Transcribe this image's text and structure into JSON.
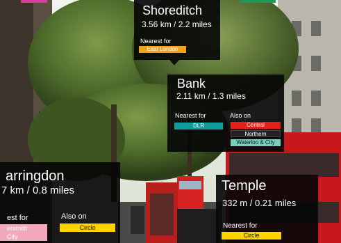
{
  "scene": {
    "description_icon": "street-camera-view"
  },
  "stations": {
    "shoreditch": {
      "name": "Shoreditch",
      "distance": "3.56 km / 2.2 miles",
      "nearest_label": "Nearest for",
      "nearest_lines": [
        {
          "name": "East London",
          "bg": "#f0a21e",
          "fg": "#ffffff"
        }
      ]
    },
    "bank": {
      "name": "Bank",
      "distance": "2.11 km / 1.3 miles",
      "nearest_label": "Nearest for",
      "also_label": "Also on",
      "nearest_lines": [
        {
          "name": "DLR",
          "bg": "#0f9c9b",
          "fg": "#ffffff"
        }
      ],
      "also_lines": [
        {
          "name": "Central",
          "bg": "#e32017",
          "fg": "#ffffff"
        },
        {
          "name": "Northern",
          "bg": "#222222",
          "fg": "#ffffff"
        },
        {
          "name": "Waterloo & City",
          "bg": "#76d0bd",
          "fg": "#111111"
        }
      ]
    },
    "farringdon": {
      "name": "arringdon",
      "distance": "7 km / 0.8 miles",
      "nearest_label": "est for",
      "also_label": "Also on",
      "nearest_lines": [
        {
          "name": "ersmith",
          "bg": "#f3a9bb",
          "fg": "#ffffff"
        },
        {
          "name": "City",
          "bg": "#f3a9bb",
          "fg": "#ffffff"
        }
      ],
      "also_lines": [
        {
          "name": "Circle",
          "bg": "#ffd300",
          "fg": "#111111"
        }
      ]
    },
    "temple": {
      "name": "Temple",
      "distance": "332 m / 0.21 miles",
      "nearest_label": "Nearest for",
      "nearest_lines": [
        {
          "name": "Circle",
          "bg": "#ffd300",
          "fg": "#111111"
        }
      ]
    }
  }
}
